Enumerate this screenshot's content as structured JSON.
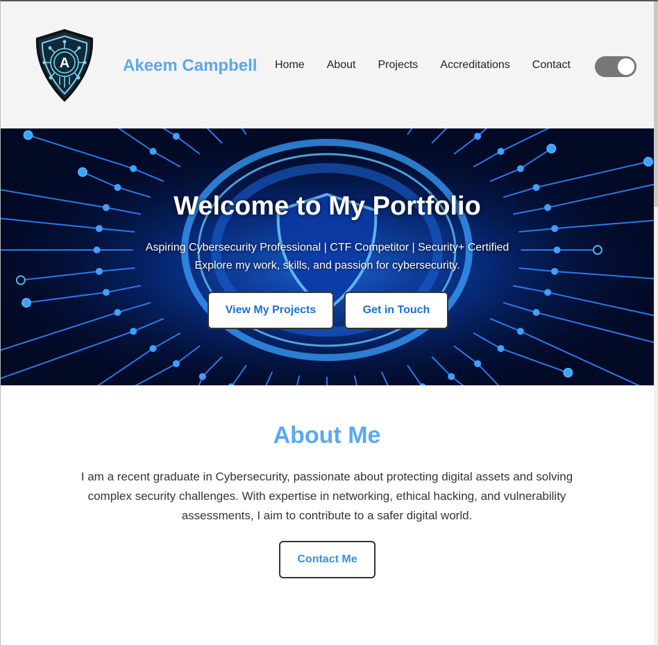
{
  "header": {
    "brand_name": "Akeem Campbell",
    "logo_letter": "A",
    "nav": [
      {
        "label": "Home"
      },
      {
        "label": "About"
      },
      {
        "label": "Projects"
      },
      {
        "label": "Accreditations"
      },
      {
        "label": "Contact"
      }
    ],
    "theme_toggle_on": true
  },
  "hero": {
    "title": "Welcome to My Portfolio",
    "subtitle_line1": "Aspiring Cybersecurity Professional | CTF Competitor | Security+ Certified",
    "subtitle_line2": "Explore my work, skills, and passion for cybersecurity.",
    "primary_button": "View My Projects",
    "secondary_button": "Get in Touch"
  },
  "about": {
    "title": "About Me",
    "text": "I am a recent graduate in Cybersecurity, passionate about protecting digital assets and solving complex security challenges. With expertise in networking, ethical hacking, and vulnerability assessments, I aim to contribute to a safer digital world.",
    "button": "Contact Me"
  },
  "colors": {
    "accent": "#5aa8f0",
    "button_text": "#1a6fd6",
    "header_bg": "#f4f4f4",
    "hero_bg": "#020a26"
  }
}
